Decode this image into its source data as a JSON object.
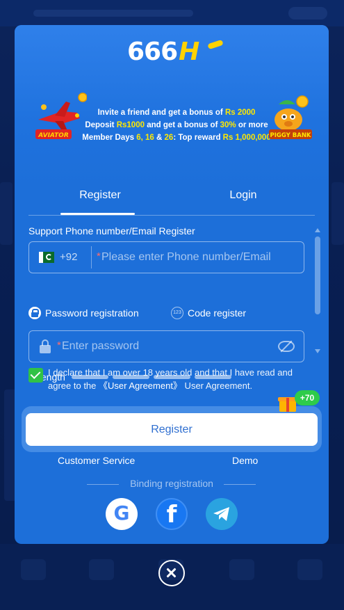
{
  "brand": {
    "logo_text": "666",
    "logo_accent": "H"
  },
  "promo": {
    "left_badge": "AVIATOR",
    "right_badge": "PIGGY BANK",
    "line1_prefix": "Invite a friend and get a bonus of ",
    "line1_amount": "Rs 2000",
    "line2_prefix": "Deposit ",
    "line2_amount": "Rs1000",
    "line2_middle": " and get a bonus of ",
    "line2_percent": "30%",
    "line2_suffix": " or more",
    "line3_prefix": "Member Days ",
    "line3_days": "6, 16",
    "line3_and": " & ",
    "line3_day26": "26",
    "line3_middle": ": Top reward ",
    "line3_reward": "Rs 1,000,000"
  },
  "tabs": [
    {
      "label": "Register",
      "active": true
    },
    {
      "label": "Login",
      "active": false
    }
  ],
  "form": {
    "section_label": "Support Phone number/Email Register",
    "country_code": "+92",
    "phone_placeholder": "Please enter Phone number/Email",
    "password_mode_label": "Password registration",
    "code_mode_label": "Code register",
    "code_icon_text": "123",
    "password_placeholder": "Enter password",
    "strength_label": "Strength",
    "strength_level": 0
  },
  "agreement": {
    "checked": true,
    "text_before": "I declare that I am over 18 years old and that I have read and agree to the ",
    "link_text": "《User Agreement》",
    "text_after": " User Agreement."
  },
  "register_button": {
    "label": "Register",
    "bonus_badge": "+70"
  },
  "footer": {
    "customer_service": "Customer Service",
    "demo": "Demo",
    "binding_label": "Binding registration"
  },
  "social": [
    "google-icon",
    "facebook-icon",
    "telegram-icon"
  ],
  "colors": {
    "modal_bg": "#1d6fd9",
    "highlight": "#ffe800",
    "check_green": "#31c246",
    "button_text": "#2f6fd0"
  }
}
